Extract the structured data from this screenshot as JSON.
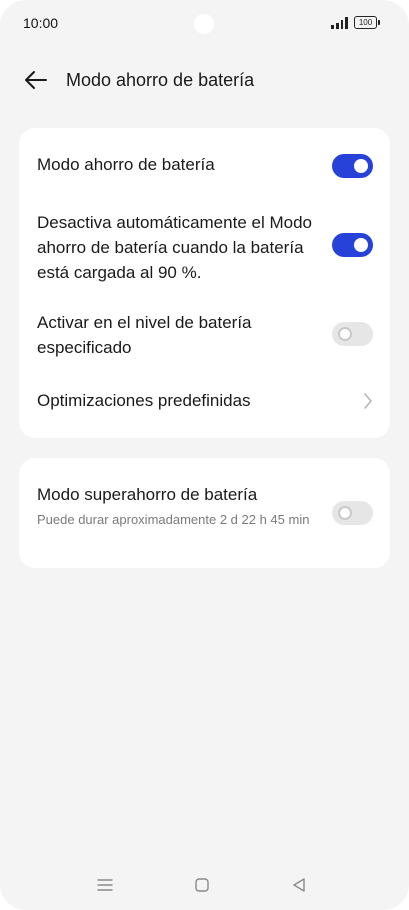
{
  "status_bar": {
    "time": "10:00",
    "battery_level": "100",
    "signal_icon": "signal-icon",
    "battery_icon": "battery-icon"
  },
  "header": {
    "back_icon": "arrow-left-icon",
    "title": "Modo ahorro de batería"
  },
  "settings": {
    "card1": {
      "rows": [
        {
          "label": "Modo ahorro de batería",
          "control": "toggle",
          "state": "on"
        },
        {
          "label": "Desactiva automáticamente el Modo ahorro de batería cuando la batería está cargada al 90 %.",
          "control": "toggle",
          "state": "on"
        },
        {
          "label": "Activar en el nivel de batería especificado",
          "control": "toggle",
          "state": "off"
        },
        {
          "label": "Optimizaciones predefinidas",
          "control": "chevron"
        }
      ]
    },
    "card2": {
      "rows": [
        {
          "label": "Modo superahorro de batería",
          "sublabel": "Puede durar aproximadamente 2 d 22 h 45 min",
          "control": "toggle",
          "state": "off"
        }
      ]
    }
  },
  "nav_bar": {
    "icons": [
      "menu-icon",
      "home-icon",
      "back-triangle-icon"
    ]
  },
  "colors": {
    "accent": "#2642d8",
    "background": "#f4f4f4",
    "card": "#ffffff",
    "toggle_off": "#e6e6e6",
    "secondary_text": "#7a7a7a"
  }
}
